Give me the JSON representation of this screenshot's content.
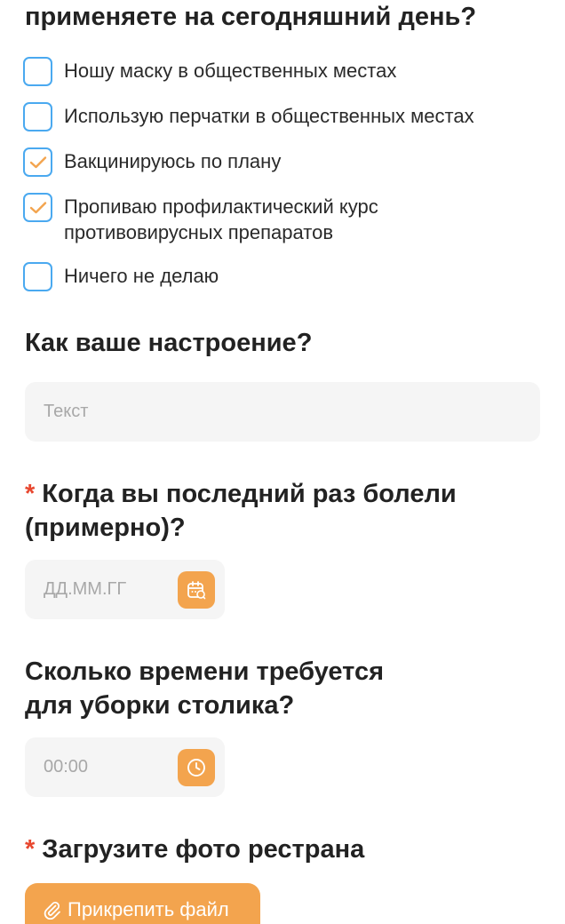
{
  "q_prevention": {
    "title_line_top": "применяете на сегодняшний день?",
    "options": [
      {
        "label": "Ношу маску в общественных местах",
        "checked": false
      },
      {
        "label": "Использую перчатки в общественных местах",
        "checked": false
      },
      {
        "label": "Вакцинируюсь по плану",
        "checked": true
      },
      {
        "label": "Пропиваю профилактический курс противовирусных препаратов",
        "checked": true
      },
      {
        "label": "Ничего не делаю",
        "checked": false
      }
    ]
  },
  "q_mood": {
    "title": "Как ваше настроение?",
    "placeholder": "Текст"
  },
  "q_last_ill": {
    "required_mark": "*",
    "title_line1": "Когда вы последний раз болели",
    "title_line2": "(примерно)?",
    "placeholder": "ДД.ММ.ГГ",
    "icon": "calendar-icon"
  },
  "q_cleaning_time": {
    "title_line1": "Сколько времени требуется",
    "title_line2": "для уборки столика?",
    "placeholder": "00:00",
    "icon": "clock-icon"
  },
  "q_photo": {
    "required_mark": "*",
    "title": "Загрузите фото рестрана",
    "attach_label": "Прикрепить файл",
    "icon": "paperclip-icon"
  },
  "colors": {
    "accent": "#f3a44e",
    "checkbox_border": "#4aa9f0",
    "required": "#e8472f",
    "field_bg": "#f5f5f5"
  }
}
